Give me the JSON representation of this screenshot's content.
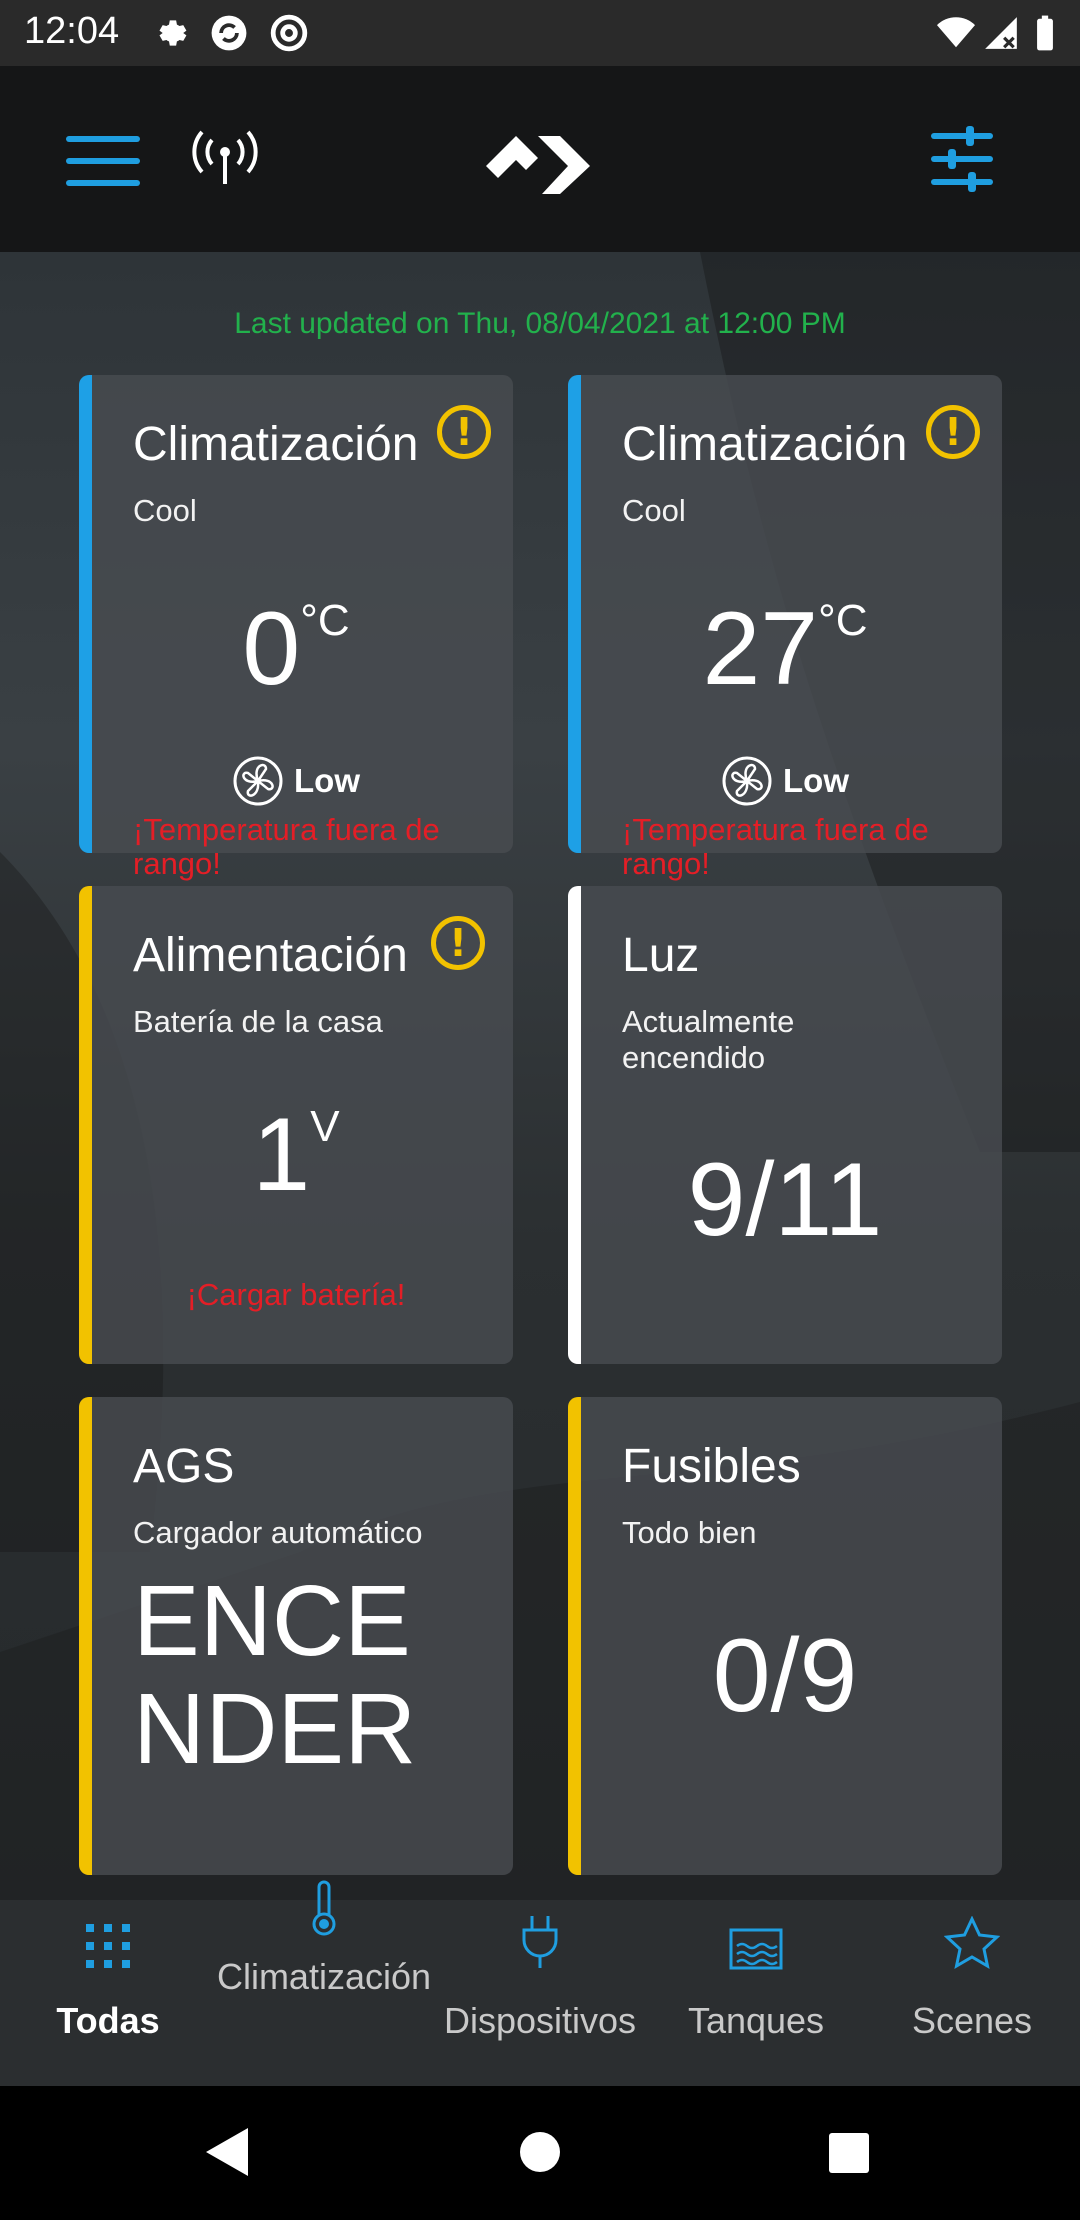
{
  "status_bar": {
    "time": "12:04"
  },
  "header": {
    "menu_icon": "hamburger-icon",
    "connection_icon": "antenna-icon",
    "logo": "brand-logo",
    "filter_icon": "sliders-icon",
    "accent_color": "#1f9ee0"
  },
  "last_updated": "Last updated on Thu, 08/04/2021 at 12:00 PM",
  "cards": [
    {
      "title": "Climatización",
      "subtitle": "Cool",
      "value": "0",
      "unit": "°C",
      "fan": "Low",
      "alert": "¡Temperatura fuera de rango!",
      "stripe": "#1ea0e6",
      "warning": "!"
    },
    {
      "title": "Climatización",
      "subtitle": "Cool",
      "value": "27",
      "unit": "°C",
      "fan": "Low",
      "alert": "¡Temperatura fuera de rango!",
      "stripe": "#1ea0e6",
      "warning": "!"
    },
    {
      "title": "Alimentación",
      "subtitle": "Batería de la casa",
      "value": "1",
      "unit": "V",
      "alert": "¡Cargar batería!",
      "stripe": "#f2c200",
      "warning": "!"
    },
    {
      "title": "Luz",
      "subtitle": "Actualmente encendido",
      "value": "9/11",
      "stripe": "#ffffff"
    },
    {
      "title": "AGS",
      "subtitle": "Cargador automático",
      "value": "ENCE NDER",
      "stripe": "#f2c200"
    },
    {
      "title": "Fusibles",
      "subtitle": "Todo bien",
      "value": "0/9",
      "stripe": "#f2c200"
    }
  ],
  "bottom_nav": [
    {
      "label": "Todas",
      "icon": "grid-icon",
      "active": true
    },
    {
      "label": "Climatización",
      "icon": "thermometer-icon"
    },
    {
      "label": "Dispositivos",
      "icon": "plug-icon"
    },
    {
      "label": "Tanques",
      "icon": "tank-icon"
    },
    {
      "label": "Scenes",
      "icon": "star-icon"
    }
  ]
}
